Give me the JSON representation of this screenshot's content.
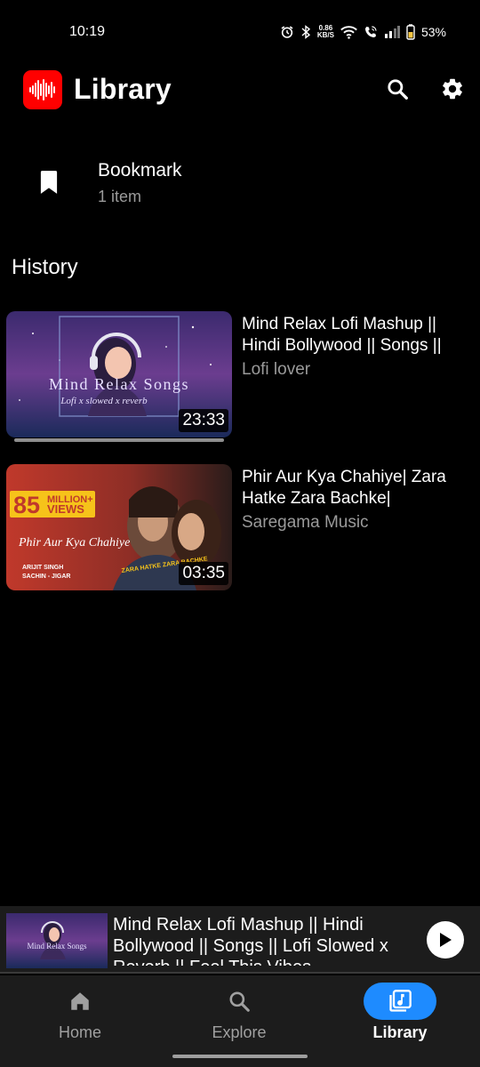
{
  "status_bar": {
    "time": "10:19",
    "net_speed_value": "0.86",
    "net_speed_unit": "KB/S",
    "battery": "53%",
    "icons": [
      "alarm-icon",
      "bluetooth-icon",
      "wifi-icon",
      "wifi-call-icon",
      "signal-icon",
      "battery-icon"
    ]
  },
  "header": {
    "title": "Library",
    "logo_icon": "audio-wave-logo",
    "search_icon": "search-icon",
    "settings_icon": "gear-icon",
    "accent_color": "#ff0000"
  },
  "bookmark": {
    "title": "Bookmark",
    "count": "1 item",
    "icon": "bookmark-icon"
  },
  "history": {
    "heading": "History",
    "items": [
      {
        "title": "Mind Relax Lofi Mashup || Hindi Bollywood || Songs ||",
        "channel": "Lofi lover",
        "duration": "23:33",
        "thumb_text_main": "Mind Relax Songs",
        "thumb_text_sub": "Lofi x slowed x reverb",
        "watched_fraction": 1.0
      },
      {
        "title": "Phir Aur Kya Chahiye| Zara Hatke Zara Bachke|",
        "channel": "Saregama Music",
        "duration": "03:35",
        "thumb_badge_number": "85",
        "thumb_badge_top": "MILLION+",
        "thumb_badge_bottom": "VIEWS",
        "thumb_script": "Phir Aur Kya Chahiye",
        "thumb_credit_1": "ARIJIT SINGH",
        "thumb_credit_2": "SACHIN - JIGAR",
        "thumb_film_title": "ZARA HATKE ZARA BACHKE"
      }
    ]
  },
  "mini_player": {
    "title": "Mind Relax Lofi Mashup || Hindi Bollywood || Songs || Lofi Slowed x Reverb || Feel This Vibes",
    "thumb_text": "Mind Relax Songs",
    "play_icon": "play-icon"
  },
  "nav": {
    "items": [
      {
        "label": "Home",
        "icon": "home-icon",
        "active": false
      },
      {
        "label": "Explore",
        "icon": "search-icon",
        "active": false
      },
      {
        "label": "Library",
        "icon": "library-music-icon",
        "active": true
      }
    ],
    "active_color": "#1e8bff"
  }
}
